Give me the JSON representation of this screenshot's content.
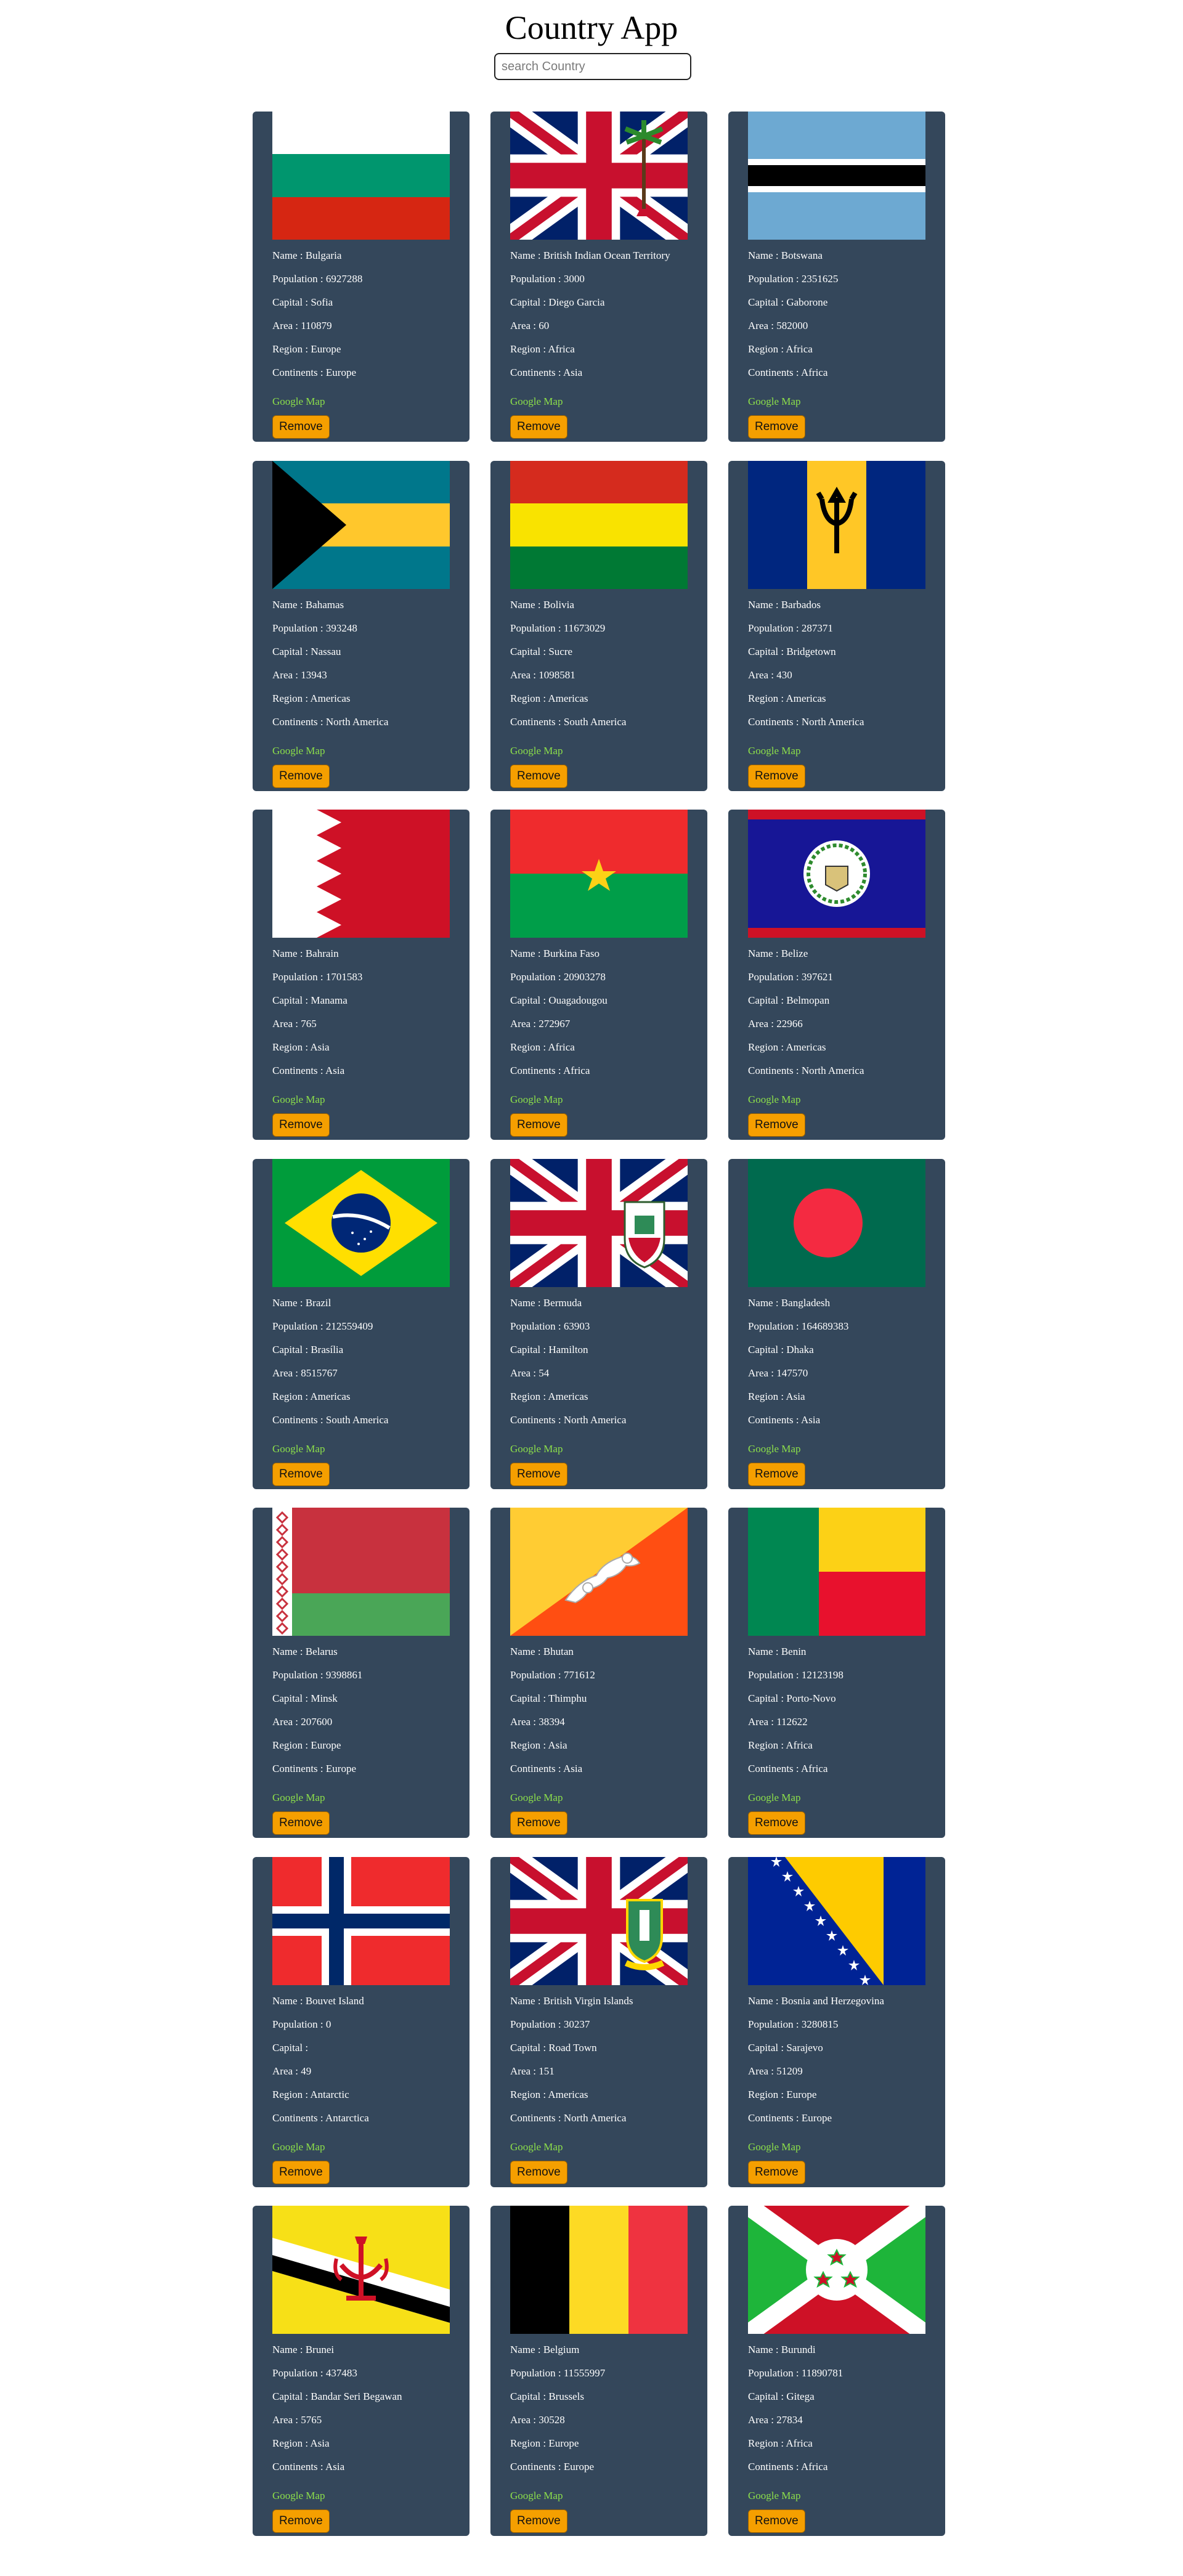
{
  "header": {
    "title": "Country App"
  },
  "search": {
    "placeholder": "search Country",
    "value": ""
  },
  "labels": {
    "name": "Name : ",
    "population": "Population : ",
    "capital": "Capital : ",
    "area": "Area : ",
    "region": "Region : ",
    "continents": "Continents : ",
    "map_link": "Google Map",
    "remove": "Remove"
  },
  "colors": {
    "card_bg": "#34475b",
    "link": "#8de04a",
    "button": "#f59f00"
  },
  "countries": [
    {
      "name": "Bulgaria",
      "population": "6927288",
      "capital": "Sofia",
      "area": "110879",
      "region": "Europe",
      "continents": "Europe",
      "flag": "bulgaria-flag"
    },
    {
      "name": "British Indian Ocean Territory",
      "population": "3000",
      "capital": "Diego Garcia",
      "area": "60",
      "region": "Africa",
      "continents": "Asia",
      "flag": "biot-flag"
    },
    {
      "name": "Botswana",
      "population": "2351625",
      "capital": "Gaborone",
      "area": "582000",
      "region": "Africa",
      "continents": "Africa",
      "flag": "botswana-flag"
    },
    {
      "name": "Bahamas",
      "population": "393248",
      "capital": "Nassau",
      "area": "13943",
      "region": "Americas",
      "continents": "North America",
      "flag": "bahamas-flag"
    },
    {
      "name": "Bolivia",
      "population": "11673029",
      "capital": "Sucre",
      "area": "1098581",
      "region": "Americas",
      "continents": "South America",
      "flag": "bolivia-flag"
    },
    {
      "name": "Barbados",
      "population": "287371",
      "capital": "Bridgetown",
      "area": "430",
      "region": "Americas",
      "continents": "North America",
      "flag": "barbados-flag"
    },
    {
      "name": "Bahrain",
      "population": "1701583",
      "capital": "Manama",
      "area": "765",
      "region": "Asia",
      "continents": "Asia",
      "flag": "bahrain-flag"
    },
    {
      "name": "Burkina Faso",
      "population": "20903278",
      "capital": "Ouagadougou",
      "area": "272967",
      "region": "Africa",
      "continents": "Africa",
      "flag": "burkina-faso-flag"
    },
    {
      "name": "Belize",
      "population": "397621",
      "capital": "Belmopan",
      "area": "22966",
      "region": "Americas",
      "continents": "North America",
      "flag": "belize-flag"
    },
    {
      "name": "Brazil",
      "population": "212559409",
      "capital": "Brasília",
      "area": "8515767",
      "region": "Americas",
      "continents": "South America",
      "flag": "brazil-flag"
    },
    {
      "name": "Bermuda",
      "population": "63903",
      "capital": "Hamilton",
      "area": "54",
      "region": "Americas",
      "continents": "North America",
      "flag": "bermuda-flag"
    },
    {
      "name": "Bangladesh",
      "population": "164689383",
      "capital": "Dhaka",
      "area": "147570",
      "region": "Asia",
      "continents": "Asia",
      "flag": "bangladesh-flag"
    },
    {
      "name": "Belarus",
      "population": "9398861",
      "capital": "Minsk",
      "area": "207600",
      "region": "Europe",
      "continents": "Europe",
      "flag": "belarus-flag"
    },
    {
      "name": "Bhutan",
      "population": "771612",
      "capital": "Thimphu",
      "area": "38394",
      "region": "Asia",
      "continents": "Asia",
      "flag": "bhutan-flag"
    },
    {
      "name": "Benin",
      "population": "12123198",
      "capital": "Porto-Novo",
      "area": "112622",
      "region": "Africa",
      "continents": "Africa",
      "flag": "benin-flag"
    },
    {
      "name": "Bouvet Island",
      "population": "0",
      "capital": "",
      "area": "49",
      "region": "Antarctic",
      "continents": "Antarctica",
      "flag": "bouvet-island-flag"
    },
    {
      "name": "British Virgin Islands",
      "population": "30237",
      "capital": "Road Town",
      "area": "151",
      "region": "Americas",
      "continents": "North America",
      "flag": "bvi-flag"
    },
    {
      "name": "Bosnia and Herzegovina",
      "population": "3280815",
      "capital": "Sarajevo",
      "area": "51209",
      "region": "Europe",
      "continents": "Europe",
      "flag": "bosnia-flag"
    },
    {
      "name": "Brunei",
      "population": "437483",
      "capital": "Bandar Seri Begawan",
      "area": "5765",
      "region": "Asia",
      "continents": "Asia",
      "flag": "brunei-flag"
    },
    {
      "name": "Belgium",
      "population": "11555997",
      "capital": "Brussels",
      "area": "30528",
      "region": "Europe",
      "continents": "Europe",
      "flag": "belgium-flag"
    },
    {
      "name": "Burundi",
      "population": "11890781",
      "capital": "Gitega",
      "area": "27834",
      "region": "Africa",
      "continents": "Africa",
      "flag": "burundi-flag"
    }
  ]
}
